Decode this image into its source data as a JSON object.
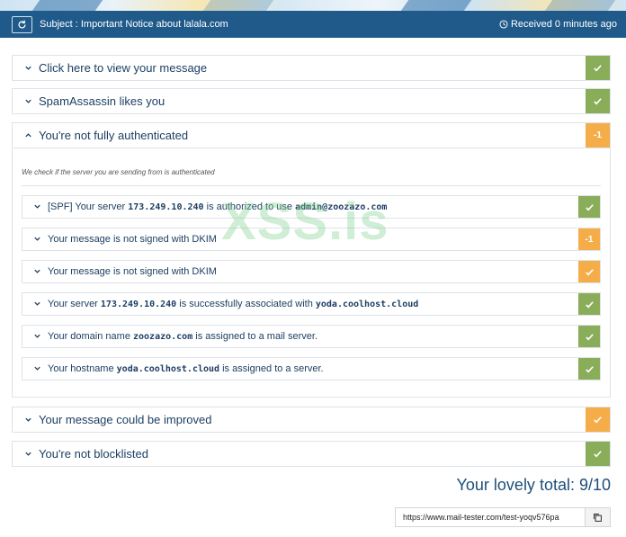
{
  "header": {
    "subject": "Subject : Important Notice about lalala.com",
    "received": "Received 0 minutes ago"
  },
  "panels": [
    {
      "title": "Click here to view your message",
      "status": "pass"
    },
    {
      "title": "SpamAssassin likes you",
      "status": "pass"
    },
    {
      "title": "You're not fully authenticated",
      "status": "warn",
      "score": "-1",
      "expanded": true
    },
    {
      "title": "Your message could be improved",
      "status": "warn-check"
    },
    {
      "title": "You're not blocklisted",
      "status": "pass"
    }
  ],
  "auth": {
    "note": "We check if the server you are sending from is authenticated",
    "items": [
      {
        "pre": "[SPF] Your server ",
        "b1": "173.249.10.240",
        "mid": " is authorized to use ",
        "b2": "admin@zoozazo.com",
        "post": "",
        "status": "pass"
      },
      {
        "pre": "Your message is not signed with DKIM",
        "b1": "",
        "mid": "",
        "b2": "",
        "post": "",
        "status": "warn",
        "score": "-1"
      },
      {
        "pre": "Your message is not signed with DKIM",
        "b1": "",
        "mid": "",
        "b2": "",
        "post": "",
        "status": "warn-check"
      },
      {
        "pre": "Your server ",
        "b1": "173.249.10.240",
        "mid": " is successfully associated with ",
        "b2": "yoda.coolhost.cloud",
        "post": "",
        "status": "pass"
      },
      {
        "pre": "Your domain name ",
        "b1": "zoozazo.com",
        "mid": " is assigned to a mail server.",
        "b2": "",
        "post": "",
        "status": "pass"
      },
      {
        "pre": "Your hostname ",
        "b1": "yoda.coolhost.cloud",
        "mid": " is assigned to a server.",
        "b2": "",
        "post": "",
        "status": "pass"
      }
    ]
  },
  "total": {
    "label": "Your lovely total: 9/10"
  },
  "share": {
    "url": "https://www.mail-tester.com/test-yoqv576pa"
  },
  "watermark": "XSS.is",
  "colors": {
    "header": "#205a8a",
    "pass": "#8aad5a",
    "warn": "#f5ad4a",
    "text": "#1d3f63"
  },
  "icons": {
    "refresh": "refresh-icon",
    "clock": "clock-icon",
    "check": "check-icon",
    "chevron": "chevron-icon",
    "copy": "copy-icon"
  }
}
